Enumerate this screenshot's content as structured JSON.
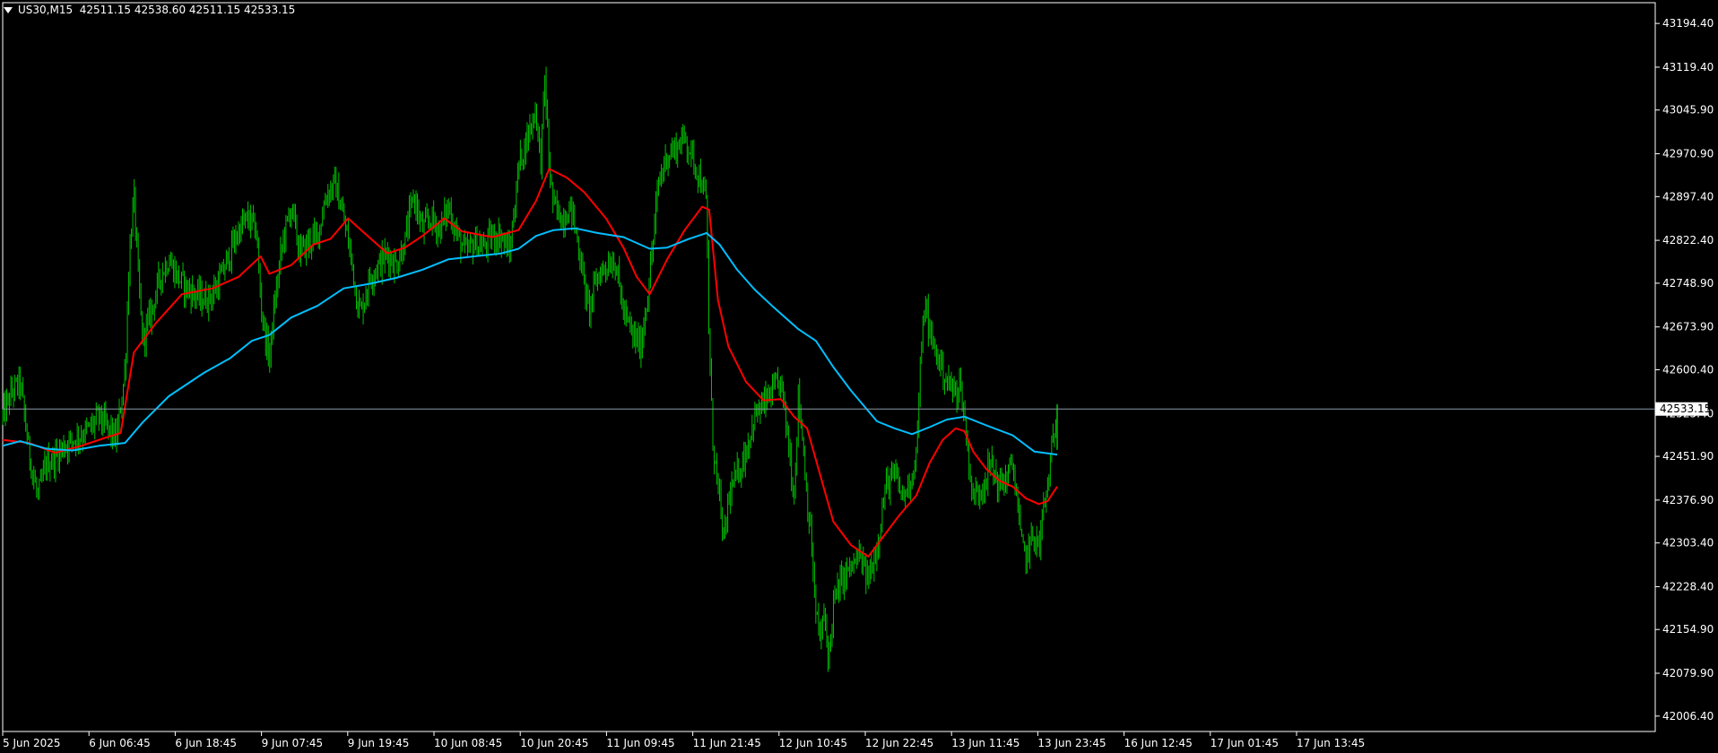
{
  "chart_data": {
    "type": "candlestick",
    "symbol": "US30,M15",
    "ohlc_header": "42511.15 42538.60 42511.15 42533.15",
    "current_price": 42533.15,
    "current_price_label": "42533.15",
    "ylim": [
      41980,
      43230
    ],
    "y_ticks": [
      "43194.40",
      "43119.40",
      "43045.90",
      "42970.90",
      "42897.40",
      "42822.40",
      "42748.90",
      "42673.90",
      "42600.40",
      "42525.40",
      "42451.90",
      "42376.90",
      "42303.40",
      "42228.40",
      "42154.90",
      "42079.90",
      "42006.40"
    ],
    "x_ticks": [
      "5 Jun 2025",
      "6 Jun 06:45",
      "6 Jun 18:45",
      "9 Jun 07:45",
      "9 Jun 19:45",
      "10 Jun 08:45",
      "10 Jun 20:45",
      "11 Jun 09:45",
      "11 Jun 21:45",
      "12 Jun 10:45",
      "12 Jun 22:45",
      "13 Jun 11:45",
      "13 Jun 23:45",
      "16 Jun 12:45",
      "17 Jun 01:45",
      "17 Jun 13:45"
    ],
    "price_path": [
      [
        0,
        42520
      ],
      [
        10,
        42560
      ],
      [
        20,
        42580
      ],
      [
        30,
        42460
      ],
      [
        40,
        42380
      ],
      [
        50,
        42440
      ],
      [
        60,
        42450
      ],
      [
        70,
        42470
      ],
      [
        80,
        42480
      ],
      [
        90,
        42490
      ],
      [
        100,
        42500
      ],
      [
        110,
        42520
      ],
      [
        120,
        42500
      ],
      [
        130,
        42480
      ],
      [
        140,
        42600
      ],
      [
        145,
        42800
      ],
      [
        150,
        42900
      ],
      [
        155,
        42760
      ],
      [
        160,
        42650
      ],
      [
        170,
        42700
      ],
      [
        180,
        42760
      ],
      [
        190,
        42790
      ],
      [
        200,
        42760
      ],
      [
        210,
        42740
      ],
      [
        220,
        42730
      ],
      [
        230,
        42720
      ],
      [
        240,
        42730
      ],
      [
        250,
        42760
      ],
      [
        260,
        42800
      ],
      [
        270,
        42840
      ],
      [
        280,
        42860
      ],
      [
        290,
        42840
      ],
      [
        295,
        42720
      ],
      [
        300,
        42660
      ],
      [
        305,
        42620
      ],
      [
        310,
        42700
      ],
      [
        320,
        42820
      ],
      [
        330,
        42880
      ],
      [
        340,
        42800
      ],
      [
        350,
        42820
      ],
      [
        360,
        42830
      ],
      [
        370,
        42900
      ],
      [
        380,
        42920
      ],
      [
        390,
        42860
      ],
      [
        400,
        42780
      ],
      [
        405,
        42720
      ],
      [
        410,
        42700
      ],
      [
        420,
        42760
      ],
      [
        430,
        42780
      ],
      [
        440,
        42800
      ],
      [
        450,
        42780
      ],
      [
        460,
        42820
      ],
      [
        470,
        42900
      ],
      [
        480,
        42840
      ],
      [
        490,
        42860
      ],
      [
        500,
        42840
      ],
      [
        510,
        42880
      ],
      [
        520,
        42830
      ],
      [
        530,
        42800
      ],
      [
        540,
        42820
      ],
      [
        550,
        42810
      ],
      [
        560,
        42830
      ],
      [
        570,
        42830
      ],
      [
        580,
        42800
      ],
      [
        590,
        42950
      ],
      [
        600,
        43000
      ],
      [
        610,
        43050
      ],
      [
        615,
        42950
      ],
      [
        620,
        43100
      ],
      [
        625,
        42950
      ],
      [
        630,
        42880
      ],
      [
        640,
        42860
      ],
      [
        650,
        42880
      ],
      [
        660,
        42800
      ],
      [
        670,
        42700
      ],
      [
        680,
        42760
      ],
      [
        690,
        42780
      ],
      [
        700,
        42790
      ],
      [
        710,
        42700
      ],
      [
        720,
        42660
      ],
      [
        730,
        42640
      ],
      [
        740,
        42760
      ],
      [
        750,
        42920
      ],
      [
        760,
        42970
      ],
      [
        770,
        42980
      ],
      [
        780,
        43000
      ],
      [
        790,
        42960
      ],
      [
        800,
        42920
      ],
      [
        805,
        42880
      ],
      [
        808,
        42640
      ],
      [
        812,
        42480
      ],
      [
        818,
        42400
      ],
      [
        825,
        42300
      ],
      [
        830,
        42380
      ],
      [
        840,
        42420
      ],
      [
        850,
        42460
      ],
      [
        860,
        42520
      ],
      [
        870,
        42540
      ],
      [
        880,
        42560
      ],
      [
        890,
        42580
      ],
      [
        895,
        42520
      ],
      [
        900,
        42460
      ],
      [
        905,
        42380
      ],
      [
        910,
        42560
      ],
      [
        915,
        42480
      ],
      [
        920,
        42380
      ],
      [
        925,
        42300
      ],
      [
        930,
        42180
      ],
      [
        935,
        42140
      ],
      [
        940,
        42180
      ],
      [
        945,
        42100
      ],
      [
        950,
        42200
      ],
      [
        960,
        42240
      ],
      [
        970,
        42260
      ],
      [
        980,
        42280
      ],
      [
        990,
        42240
      ],
      [
        1000,
        42300
      ],
      [
        1010,
        42400
      ],
      [
        1020,
        42420
      ],
      [
        1030,
        42380
      ],
      [
        1040,
        42420
      ],
      [
        1045,
        42460
      ],
      [
        1050,
        42620
      ],
      [
        1055,
        42720
      ],
      [
        1060,
        42660
      ],
      [
        1070,
        42620
      ],
      [
        1080,
        42580
      ],
      [
        1090,
        42560
      ],
      [
        1095,
        42580
      ],
      [
        1100,
        42520
      ],
      [
        1105,
        42440
      ],
      [
        1110,
        42380
      ],
      [
        1120,
        42400
      ],
      [
        1130,
        42440
      ],
      [
        1140,
        42400
      ],
      [
        1150,
        42420
      ],
      [
        1155,
        42440
      ],
      [
        1160,
        42380
      ],
      [
        1165,
        42300
      ],
      [
        1170,
        42280
      ],
      [
        1180,
        42320
      ],
      [
        1185,
        42290
      ],
      [
        1190,
        42360
      ],
      [
        1195,
        42400
      ],
      [
        1200,
        42460
      ],
      [
        1206,
        42533
      ]
    ],
    "series": [
      {
        "color": "#ff0000",
        "values": [
          [
            0,
            42480
          ],
          [
            30,
            42475
          ],
          [
            60,
            42458
          ],
          [
            90,
            42470
          ],
          [
            120,
            42485
          ],
          [
            135,
            42492
          ],
          [
            150,
            42630
          ],
          [
            175,
            42680
          ],
          [
            205,
            42730
          ],
          [
            240,
            42740
          ],
          [
            270,
            42760
          ],
          [
            295,
            42795
          ],
          [
            305,
            42765
          ],
          [
            330,
            42780
          ],
          [
            355,
            42815
          ],
          [
            375,
            42825
          ],
          [
            395,
            42860
          ],
          [
            410,
            42840
          ],
          [
            440,
            42800
          ],
          [
            460,
            42810
          ],
          [
            480,
            42830
          ],
          [
            505,
            42860
          ],
          [
            525,
            42838
          ],
          [
            560,
            42828
          ],
          [
            590,
            42840
          ],
          [
            610,
            42890
          ],
          [
            625,
            42945
          ],
          [
            645,
            42930
          ],
          [
            665,
            42905
          ],
          [
            690,
            42860
          ],
          [
            710,
            42810
          ],
          [
            725,
            42760
          ],
          [
            740,
            42730
          ],
          [
            760,
            42790
          ],
          [
            780,
            42840
          ],
          [
            800,
            42880
          ],
          [
            808,
            42875
          ],
          [
            818,
            42720
          ],
          [
            830,
            42640
          ],
          [
            850,
            42580
          ],
          [
            870,
            42548
          ],
          [
            890,
            42550
          ],
          [
            905,
            42520
          ],
          [
            920,
            42500
          ],
          [
            935,
            42420
          ],
          [
            950,
            42340
          ],
          [
            970,
            42300
          ],
          [
            990,
            42280
          ],
          [
            1005,
            42310
          ],
          [
            1025,
            42350
          ],
          [
            1045,
            42385
          ],
          [
            1060,
            42440
          ],
          [
            1075,
            42480
          ],
          [
            1090,
            42500
          ],
          [
            1100,
            42495
          ],
          [
            1110,
            42460
          ],
          [
            1125,
            42430
          ],
          [
            1140,
            42410
          ],
          [
            1155,
            42400
          ],
          [
            1170,
            42380
          ],
          [
            1185,
            42370
          ],
          [
            1195,
            42375
          ],
          [
            1206,
            42400
          ]
        ]
      },
      {
        "color": "#00bfff",
        "values": [
          [
            0,
            42470
          ],
          [
            20,
            42478
          ],
          [
            50,
            42465
          ],
          [
            80,
            42462
          ],
          [
            110,
            42470
          ],
          [
            140,
            42475
          ],
          [
            160,
            42510
          ],
          [
            190,
            42555
          ],
          [
            230,
            42595
          ],
          [
            260,
            42620
          ],
          [
            285,
            42650
          ],
          [
            305,
            42660
          ],
          [
            330,
            42690
          ],
          [
            360,
            42710
          ],
          [
            390,
            42740
          ],
          [
            420,
            42748
          ],
          [
            450,
            42758
          ],
          [
            480,
            42772
          ],
          [
            510,
            42790
          ],
          [
            540,
            42795
          ],
          [
            570,
            42800
          ],
          [
            590,
            42808
          ],
          [
            610,
            42830
          ],
          [
            630,
            42840
          ],
          [
            655,
            42843
          ],
          [
            680,
            42835
          ],
          [
            710,
            42828
          ],
          [
            740,
            42808
          ],
          [
            760,
            42810
          ],
          [
            785,
            42825
          ],
          [
            805,
            42835
          ],
          [
            820,
            42815
          ],
          [
            840,
            42772
          ],
          [
            860,
            42738
          ],
          [
            880,
            42710
          ],
          [
            910,
            42670
          ],
          [
            930,
            42650
          ],
          [
            950,
            42605
          ],
          [
            970,
            42565
          ],
          [
            1000,
            42512
          ],
          [
            1020,
            42500
          ],
          [
            1040,
            42490
          ],
          [
            1060,
            42502
          ],
          [
            1080,
            42515
          ],
          [
            1100,
            42520
          ],
          [
            1125,
            42505
          ],
          [
            1155,
            42488
          ],
          [
            1180,
            42460
          ],
          [
            1206,
            42455
          ]
        ]
      }
    ]
  }
}
